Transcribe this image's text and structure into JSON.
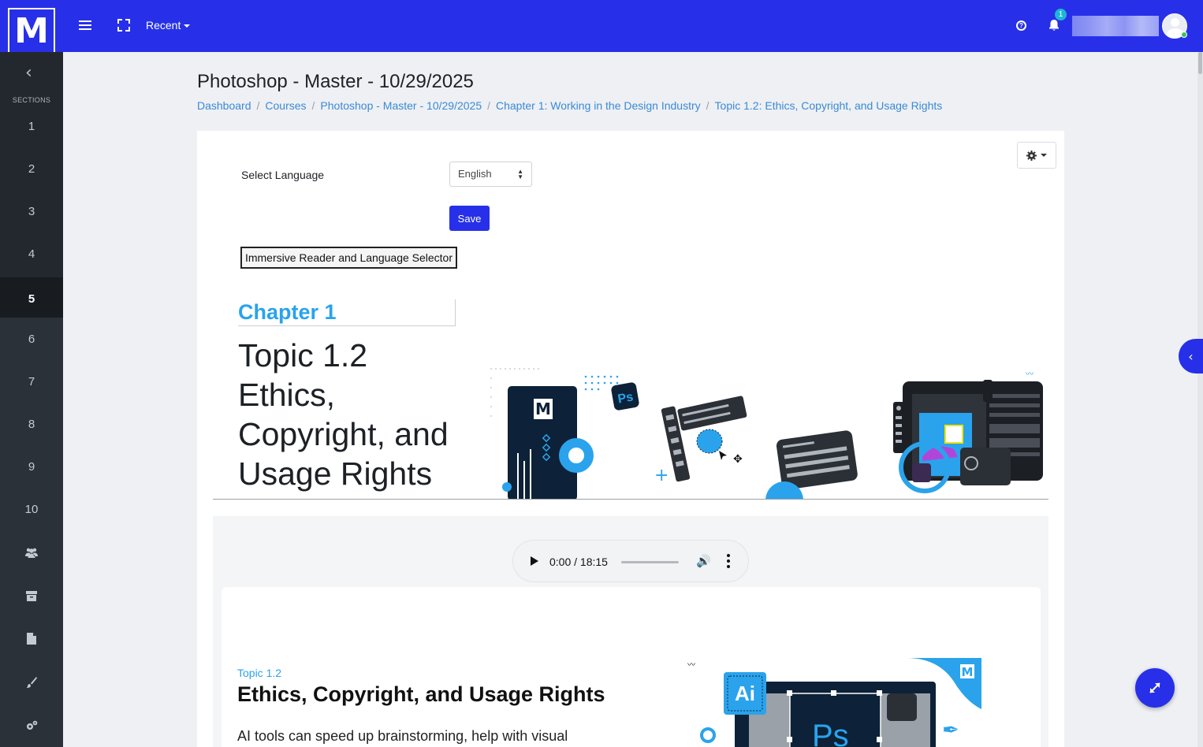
{
  "navbar": {
    "logo_letter": "M",
    "recent_label": "Recent",
    "help_icon": "question-circle-icon",
    "notification_count": "1",
    "brand_color": "#2730e8"
  },
  "sidebar": {
    "sections_label": "SECTIONS",
    "sections": [
      "1",
      "2",
      "3",
      "4",
      "5",
      "6",
      "7",
      "8",
      "9",
      "10"
    ],
    "active_section": "5",
    "tools": [
      "users-icon",
      "archive-icon",
      "file-icon",
      "brush-icon",
      "cogs-icon"
    ]
  },
  "page": {
    "title": "Photoshop - Master - 10/29/2025",
    "breadcrumb": [
      "Dashboard",
      "Courses",
      "Photoshop - Master - 10/29/2025",
      "Chapter 1: Working in the Design Industry",
      "Topic 1.2: Ethics, Copyright, and Usage Rights"
    ]
  },
  "language": {
    "label": "Select Language",
    "selected": "English",
    "save_label": "Save",
    "reader_button_label": "Immersive Reader and Language Selector"
  },
  "hero": {
    "chapter_label": "Chapter 1",
    "topic_lines": [
      "Topic 1.2",
      "Ethics,",
      "Copyright, and",
      "Usage Rights"
    ],
    "accent_color": "#2aa3ec"
  },
  "audio": {
    "time": "0:00 / 18:15"
  },
  "content": {
    "topic_small": "Topic 1.2",
    "topic_title": "Ethics, Copyright, and Usage Rights",
    "body_start": "AI tools can speed up brainstorming, help with visual"
  }
}
